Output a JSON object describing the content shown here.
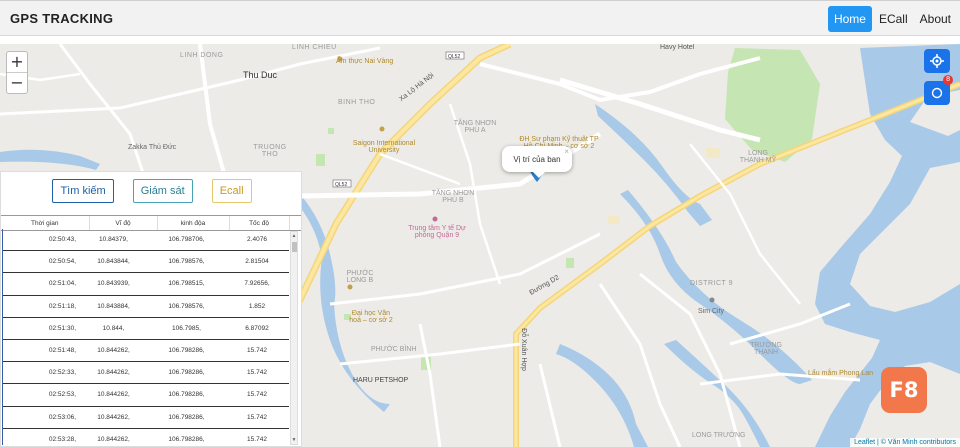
{
  "header": {
    "brand": "GPS TRACKING",
    "nav": [
      {
        "label": "Home",
        "active": true
      },
      {
        "label": "ECall",
        "active": false
      },
      {
        "label": "About",
        "active": false
      }
    ]
  },
  "map": {
    "zoom_in": "+",
    "zoom_out": "−",
    "popup_text": "Vị trí của ban",
    "popup_close": "×",
    "locate_badge": "8",
    "attribution_link": "Leaflet",
    "attribution_text": " | © Văn Minh contributors",
    "labels": [
      {
        "text": "Thu Duc",
        "cls": "dark"
      },
      {
        "text": "BINH THO",
        "cls": "dist"
      },
      {
        "text": "LINH DONG",
        "cls": "dist"
      },
      {
        "text": "LINH CHIEU",
        "cls": "dist"
      },
      {
        "text": "TRUONG THO",
        "cls": "dist"
      },
      {
        "text": "TĂNG NHƠN PHÚ A",
        "cls": "dist"
      },
      {
        "text": "TĂNG NHƠN PHÚ B",
        "cls": "dist"
      },
      {
        "text": "PHƯỚC LONG B",
        "cls": "dist"
      },
      {
        "text": "PHƯỚC BÌNH",
        "cls": "dist"
      },
      {
        "text": "LONG THẠNH MỸ",
        "cls": "dist"
      },
      {
        "text": "DISTRICT 9",
        "cls": "dist"
      },
      {
        "text": "TRƯỜNG THẠNH",
        "cls": "dist"
      },
      {
        "text": "LONG TRƯỜNG",
        "cls": "dist"
      },
      {
        "text": "Saigon International University",
        "cls": "poi"
      },
      {
        "text": "Trung tâm Y tế Dự phòng Quận 9",
        "cls": "poi"
      },
      {
        "text": "Đại học Văn hoá – cơ sở 2",
        "cls": "poi"
      },
      {
        "text": "Sim City",
        "cls": "poi"
      },
      {
        "text": "HARU PETSHOP",
        "cls": "dark"
      },
      {
        "text": "Zakka Thủ Đức",
        "cls": "dark"
      },
      {
        "text": "Ẩm thực Nai Vàng",
        "cls": "poi"
      },
      {
        "text": "Havy Hotel",
        "cls": "dark"
      },
      {
        "text": "Lẩu mắm Phong Lan",
        "cls": "poi"
      },
      {
        "text": "ĐH Sư phạm Kỹ thuật TP Hồ Chí Minh – cơ sở 2",
        "cls": "poi"
      },
      {
        "text": "Đường D2",
        "cls": "road"
      },
      {
        "text": "Xa Lộ Hà Nội",
        "cls": "road"
      },
      {
        "text": "Đỗ Xuân Hợp",
        "cls": "road"
      }
    ]
  },
  "panel": {
    "buttons": {
      "search": "Tìm kiếm",
      "monitor": "Giám sát",
      "ecall": "Ecall"
    },
    "columns": [
      "Thời gian",
      "Vĩ độ",
      "kinh độa",
      "Tốc độ"
    ],
    "rows": [
      [
        "02:50:43,",
        "10.84379,",
        "106.798706,",
        "2.4076"
      ],
      [
        "02:50:54,",
        "10.843844,",
        "106.798576,",
        "2.81504"
      ],
      [
        "02:51:04,",
        "10.843939,",
        "106.798515,",
        "7.92656,"
      ],
      [
        "02:51:18,",
        "10.843884,",
        "106.798576,",
        "1.852"
      ],
      [
        "02:51:30,",
        "10.844,",
        "106.7985,",
        "6.87092"
      ],
      [
        "02:51:48,",
        "10.844262,",
        "106.798286,",
        "15.742"
      ],
      [
        "02:52:33,",
        "10.844262,",
        "106.798286,",
        "15.742"
      ],
      [
        "02:52:53,",
        "10.844262,",
        "106.798286,",
        "15.742"
      ],
      [
        "02:53:06,",
        "10.844262,",
        "106.798286,",
        "15.742"
      ],
      [
        "02:53:28,",
        "10.844262,",
        "106.798286,",
        "15.742"
      ]
    ]
  },
  "watermark": "F8",
  "colors": {
    "accent": "#2196f3",
    "water": "#a9c9e8",
    "park": "#c5e5b2",
    "road": "#ffffff",
    "marker": "#2a82cb"
  }
}
